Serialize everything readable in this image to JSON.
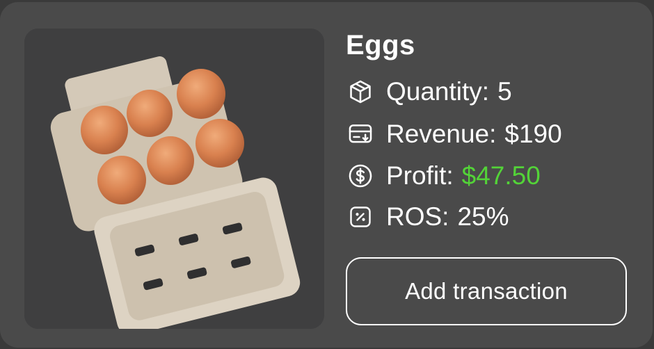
{
  "product": {
    "name": "Eggs",
    "image_alt": "Egg carton with six brown eggs",
    "stats": [
      {
        "icon": "box-icon",
        "label": "Quantity:",
        "value": "5"
      },
      {
        "icon": "card-icon",
        "label": "Revenue:",
        "value": "$190"
      },
      {
        "icon": "dollar-icon",
        "label": "Profit:",
        "value": "$47.50",
        "value_color": "#53d338"
      },
      {
        "icon": "percent-icon",
        "label": "ROS:",
        "value": "25%"
      }
    ]
  },
  "actions": {
    "add_transaction": "Add transaction"
  },
  "colors": {
    "card": "#4a4a4a",
    "background": "#3a3a3a",
    "profit": "#53d338",
    "text": "#ffffff"
  }
}
